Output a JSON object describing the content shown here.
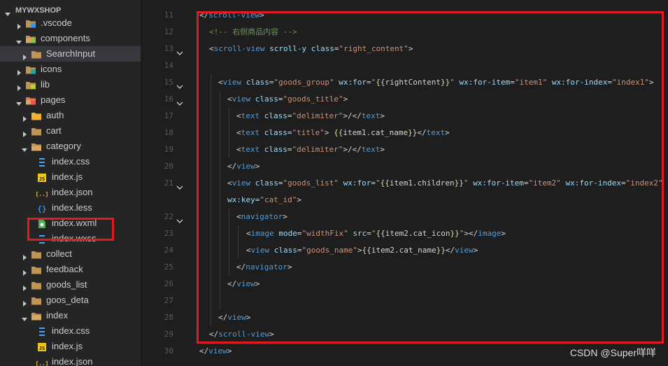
{
  "explorer": {
    "root_label": "MYWXSHOP",
    "items": [
      {
        "label": ".vscode",
        "icon": "folder-vscode-icon",
        "kind": "folder",
        "open": false,
        "depth": 1
      },
      {
        "label": "components",
        "icon": "folder-components-icon",
        "kind": "folder",
        "open": true,
        "depth": 1
      },
      {
        "label": "SearchInput",
        "icon": "folder-icon",
        "kind": "folder",
        "open": false,
        "depth": 2
      },
      {
        "label": "icons",
        "icon": "folder-icons-icon",
        "kind": "folder",
        "open": false,
        "depth": 1
      },
      {
        "label": "lib",
        "icon": "folder-lib-icon",
        "kind": "folder",
        "open": false,
        "depth": 1
      },
      {
        "label": "pages",
        "icon": "folder-pages-icon",
        "kind": "folder",
        "open": true,
        "depth": 1
      },
      {
        "label": "auth",
        "icon": "folder-auth-icon",
        "kind": "folder",
        "open": false,
        "depth": 2
      },
      {
        "label": "cart",
        "icon": "folder-icon",
        "kind": "folder",
        "open": false,
        "depth": 2
      },
      {
        "label": "category",
        "icon": "folder-open-icon",
        "kind": "folder",
        "open": true,
        "depth": 2
      },
      {
        "label": "index.css",
        "icon": "css-file-icon",
        "kind": "file",
        "depth": 3
      },
      {
        "label": "index.js",
        "icon": "js-file-icon",
        "kind": "file",
        "depth": 3
      },
      {
        "label": "index.json",
        "icon": "json-file-icon",
        "kind": "file",
        "depth": 3
      },
      {
        "label": "index.less",
        "icon": "less-file-icon",
        "kind": "file",
        "depth": 3
      },
      {
        "label": "index.wxml",
        "icon": "wxml-file-icon",
        "kind": "file",
        "depth": 3
      },
      {
        "label": "index.wxss",
        "icon": "css-file-icon",
        "kind": "file",
        "depth": 3
      },
      {
        "label": "collect",
        "icon": "folder-icon",
        "kind": "folder",
        "open": false,
        "depth": 2
      },
      {
        "label": "feedback",
        "icon": "folder-icon",
        "kind": "folder",
        "open": false,
        "depth": 2
      },
      {
        "label": "goods_list",
        "icon": "folder-icon",
        "kind": "folder",
        "open": false,
        "depth": 2
      },
      {
        "label": "goos_deta",
        "icon": "folder-icon",
        "kind": "folder",
        "open": false,
        "depth": 2
      },
      {
        "label": "index",
        "icon": "folder-open-icon",
        "kind": "folder",
        "open": true,
        "depth": 2
      },
      {
        "label": "index.css",
        "icon": "css-file-icon",
        "kind": "file",
        "depth": 3
      },
      {
        "label": "index.js",
        "icon": "js-file-icon",
        "kind": "file",
        "depth": 3
      },
      {
        "label": "index.json",
        "icon": "json-file-icon",
        "kind": "file",
        "depth": 3
      }
    ]
  },
  "editor": {
    "lines": [
      {
        "num": "11",
        "fold": false,
        "indent": 0,
        "tokens": [
          [
            "t",
            "</"
          ],
          [
            "tag",
            "scroll-view"
          ],
          [
            "t",
            ">"
          ]
        ]
      },
      {
        "num": "12",
        "fold": false,
        "indent": 1,
        "tokens": [
          [
            "comment",
            "<!-- 右侧商品内容 -->"
          ]
        ]
      },
      {
        "num": "13",
        "fold": true,
        "indent": 1,
        "tokens": [
          [
            "t",
            "<"
          ],
          [
            "tag",
            "scroll-view"
          ],
          [
            "t",
            " "
          ],
          [
            "attr",
            "scroll-y"
          ],
          [
            "t",
            " "
          ],
          [
            "attr",
            "class"
          ],
          [
            "t",
            "="
          ],
          [
            "str",
            "\"right_content\""
          ],
          [
            "t",
            ">"
          ]
        ]
      },
      {
        "num": "14",
        "fold": false,
        "indent": 1,
        "tokens": []
      },
      {
        "num": "15",
        "fold": true,
        "indent": 2,
        "tokens": [
          [
            "t",
            "<"
          ],
          [
            "tag",
            "view"
          ],
          [
            "t",
            " "
          ],
          [
            "attr",
            "class"
          ],
          [
            "t",
            "="
          ],
          [
            "str",
            "\"goods_group\""
          ],
          [
            "t",
            " "
          ],
          [
            "attr",
            "wx:for"
          ],
          [
            "t",
            "="
          ],
          [
            "str",
            "\""
          ],
          [
            "brace",
            "{{"
          ],
          [
            "t",
            "rightContent"
          ],
          [
            "brace",
            "}}"
          ],
          [
            "str",
            "\""
          ],
          [
            "t",
            " "
          ],
          [
            "attr",
            "wx:for-item"
          ],
          [
            "t",
            "="
          ],
          [
            "str",
            "\"item1\""
          ],
          [
            "t",
            " "
          ],
          [
            "attr",
            "wx:for-index"
          ],
          [
            "t",
            "="
          ],
          [
            "str",
            "\"index1\""
          ],
          [
            "t",
            ">"
          ]
        ]
      },
      {
        "num": "16",
        "fold": true,
        "indent": 3,
        "tokens": [
          [
            "t",
            "<"
          ],
          [
            "tag",
            "view"
          ],
          [
            "t",
            " "
          ],
          [
            "attr",
            "class"
          ],
          [
            "t",
            "="
          ],
          [
            "str",
            "\"goods_title\""
          ],
          [
            "t",
            ">"
          ]
        ]
      },
      {
        "num": "17",
        "fold": false,
        "indent": 4,
        "tokens": [
          [
            "t",
            "<"
          ],
          [
            "tag",
            "text"
          ],
          [
            "t",
            " "
          ],
          [
            "attr",
            "class"
          ],
          [
            "t",
            "="
          ],
          [
            "str",
            "\"delimiter\""
          ],
          [
            "t",
            ">/</"
          ],
          [
            "tag",
            "text"
          ],
          [
            "t",
            ">"
          ]
        ]
      },
      {
        "num": "18",
        "fold": false,
        "indent": 4,
        "tokens": [
          [
            "t",
            "<"
          ],
          [
            "tag",
            "text"
          ],
          [
            "t",
            " "
          ],
          [
            "attr",
            "class"
          ],
          [
            "t",
            "="
          ],
          [
            "str",
            "\"title\""
          ],
          [
            "t",
            "> "
          ],
          [
            "brace",
            "{{"
          ],
          [
            "t",
            "item1.cat_name"
          ],
          [
            "brace",
            "}}"
          ],
          [
            "t",
            "</"
          ],
          [
            "tag",
            "text"
          ],
          [
            "t",
            ">"
          ]
        ]
      },
      {
        "num": "19",
        "fold": false,
        "indent": 4,
        "tokens": [
          [
            "t",
            "<"
          ],
          [
            "tag",
            "text"
          ],
          [
            "t",
            " "
          ],
          [
            "attr",
            "class"
          ],
          [
            "t",
            "="
          ],
          [
            "str",
            "\"delimiter\""
          ],
          [
            "t",
            ">/</"
          ],
          [
            "tag",
            "text"
          ],
          [
            "t",
            ">"
          ]
        ]
      },
      {
        "num": "20",
        "fold": false,
        "indent": 3,
        "tokens": [
          [
            "t",
            "</"
          ],
          [
            "tag",
            "view"
          ],
          [
            "t",
            ">"
          ]
        ]
      },
      {
        "num": "21",
        "fold": true,
        "indent": 3,
        "tokens": [
          [
            "t",
            "<"
          ],
          [
            "tag",
            "view"
          ],
          [
            "t",
            " "
          ],
          [
            "attr",
            "class"
          ],
          [
            "t",
            "="
          ],
          [
            "str",
            "\"goods_list\""
          ],
          [
            "t",
            " "
          ],
          [
            "attr",
            "wx:for"
          ],
          [
            "t",
            "="
          ],
          [
            "str",
            "\""
          ],
          [
            "brace",
            "{{"
          ],
          [
            "t",
            "item1.children"
          ],
          [
            "brace",
            "}}"
          ],
          [
            "str",
            "\""
          ],
          [
            "t",
            " "
          ],
          [
            "attr",
            "wx:for-item"
          ],
          [
            "t",
            "="
          ],
          [
            "str",
            "\"item2\""
          ],
          [
            "t",
            " "
          ],
          [
            "attr",
            "wx:for-index"
          ],
          [
            "t",
            "="
          ],
          [
            "str",
            "\"index2\""
          ]
        ]
      },
      {
        "num": "",
        "fold": false,
        "indent": 3,
        "tokens": [
          [
            "attr",
            "wx:key"
          ],
          [
            "t",
            "="
          ],
          [
            "str",
            "\"cat_id\""
          ],
          [
            "t",
            ">"
          ]
        ]
      },
      {
        "num": "22",
        "fold": true,
        "indent": 4,
        "tokens": [
          [
            "t",
            "<"
          ],
          [
            "tag",
            "navigator"
          ],
          [
            "t",
            ">"
          ]
        ]
      },
      {
        "num": "23",
        "fold": false,
        "indent": 5,
        "tokens": [
          [
            "t",
            "<"
          ],
          [
            "tag",
            "image"
          ],
          [
            "t",
            " "
          ],
          [
            "attr",
            "mode"
          ],
          [
            "t",
            "="
          ],
          [
            "str",
            "\"widthFix\""
          ],
          [
            "t",
            " "
          ],
          [
            "attr",
            "src"
          ],
          [
            "t",
            "="
          ],
          [
            "str",
            "\""
          ],
          [
            "brace",
            "{{"
          ],
          [
            "t",
            "item2.cat_icon"
          ],
          [
            "brace",
            "}}"
          ],
          [
            "str",
            "\""
          ],
          [
            "t",
            "></"
          ],
          [
            "tag",
            "image"
          ],
          [
            "t",
            ">"
          ]
        ]
      },
      {
        "num": "24",
        "fold": false,
        "indent": 5,
        "tokens": [
          [
            "t",
            "<"
          ],
          [
            "tag",
            "view"
          ],
          [
            "t",
            " "
          ],
          [
            "attr",
            "class"
          ],
          [
            "t",
            "="
          ],
          [
            "str",
            "\"goods_name\""
          ],
          [
            "t",
            ">"
          ],
          [
            "brace",
            "{{"
          ],
          [
            "t",
            "item2.cat_name"
          ],
          [
            "brace",
            "}}"
          ],
          [
            "t",
            "</"
          ],
          [
            "tag",
            "view"
          ],
          [
            "t",
            ">"
          ]
        ]
      },
      {
        "num": "25",
        "fold": false,
        "indent": 4,
        "tokens": [
          [
            "t",
            "</"
          ],
          [
            "tag",
            "navigator"
          ],
          [
            "t",
            ">"
          ]
        ]
      },
      {
        "num": "26",
        "fold": false,
        "indent": 3,
        "tokens": [
          [
            "t",
            "</"
          ],
          [
            "tag",
            "view"
          ],
          [
            "t",
            ">"
          ]
        ]
      },
      {
        "num": "27",
        "fold": false,
        "indent": 3,
        "tokens": []
      },
      {
        "num": "28",
        "fold": false,
        "indent": 2,
        "tokens": [
          [
            "t",
            "</"
          ],
          [
            "tag",
            "view"
          ],
          [
            "t",
            ">"
          ]
        ]
      },
      {
        "num": "29",
        "fold": false,
        "indent": 1,
        "tokens": [
          [
            "t",
            "</"
          ],
          [
            "tag",
            "scroll-view"
          ],
          [
            "t",
            ">"
          ]
        ]
      },
      {
        "num": "30",
        "fold": false,
        "indent": 0,
        "tokens": [
          [
            "t",
            "</"
          ],
          [
            "tag",
            "view"
          ],
          [
            "t",
            ">"
          ]
        ]
      }
    ]
  },
  "watermark": "CSDN @Super咩咩",
  "colors": {
    "highlight_box": "#e01b24",
    "tag": "#569cd6",
    "attribute": "#9cdcfe",
    "string": "#ce9178",
    "mustache": "#dcdcaa",
    "comment": "#6a9955",
    "sidebar_bg": "#252526",
    "editor_bg": "#1e1e1e"
  }
}
